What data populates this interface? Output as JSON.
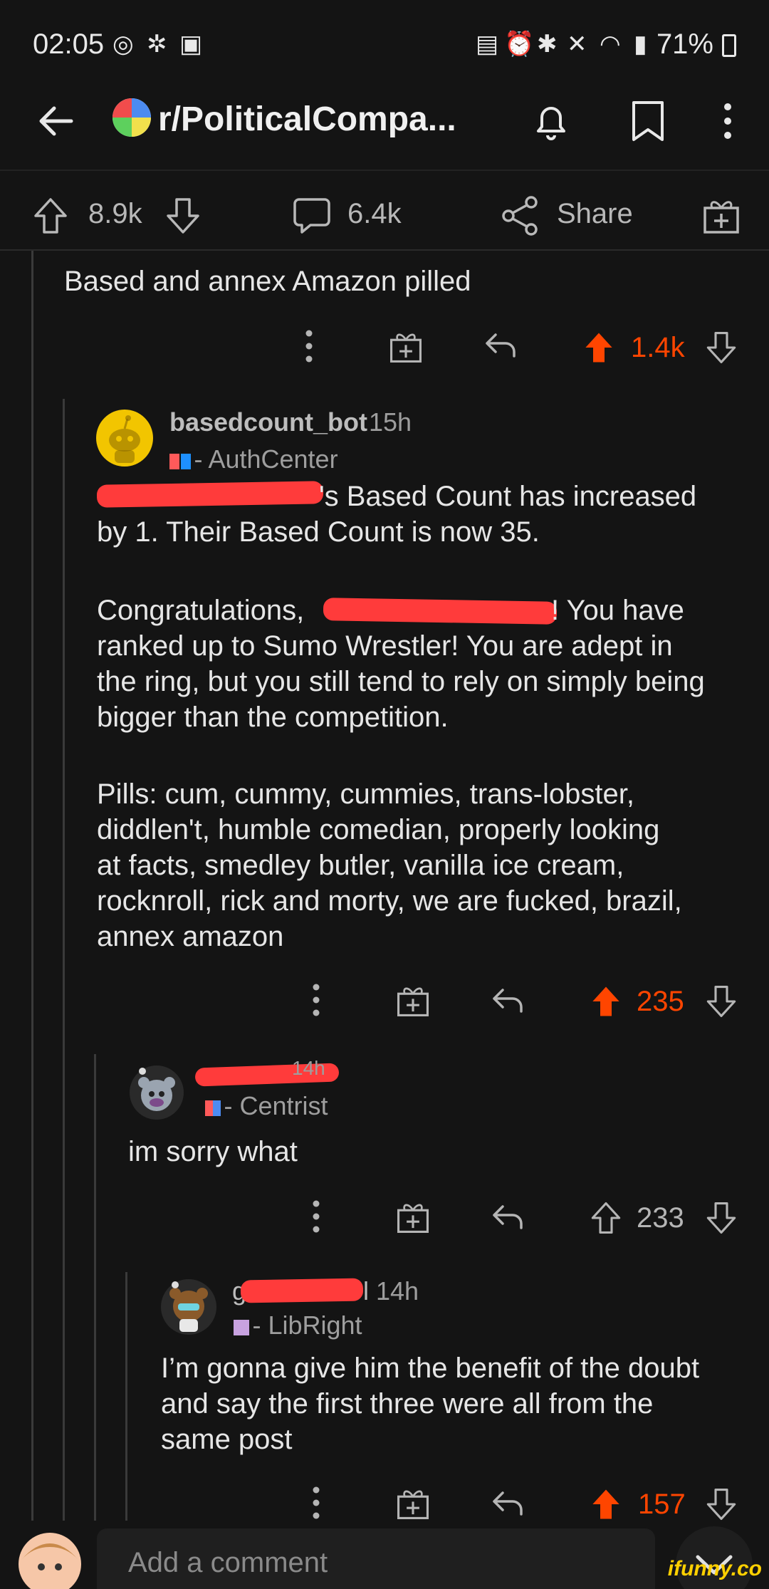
{
  "status_bar": {
    "time": "02:05",
    "battery_pct": "71%"
  },
  "header": {
    "subreddit": "r/PoliticalCompa..."
  },
  "post_actions": {
    "upvotes": "8.9k",
    "comments": "6.4k",
    "share_label": "Share"
  },
  "comments": [
    {
      "text": "Based and annex Amazon pilled",
      "score": "1.4k"
    },
    {
      "username": "basedcount_bot",
      "age": "15h",
      "flair": "- AuthCenter",
      "p1_tail": "'s Based Count has increased",
      "p1_line2": "by 1. Their Based Count is now 35.",
      "p2_head": "Congratulations,",
      "p2_tail": "! You have",
      "p2_rest": [
        "ranked up to Sumo Wrestler! You are adept in",
        "the ring, but you still tend to rely on simply being",
        "bigger than the competition."
      ],
      "p3": [
        "Pills: cum, cummy, cummies, trans-lobster,",
        "diddlen't, humble comedian, properly looking",
        "at facts, smedley butler, vanilla ice cream,",
        "rocknroll, rick and morty, we are fucked, brazil,",
        "annex amazon"
      ],
      "score": "235"
    },
    {
      "age": "14h",
      "flair": "- Centrist",
      "text": "im sorry what",
      "score": "233"
    },
    {
      "name_head": "g",
      "name_tail": "l",
      "age": "14h",
      "flair": "- LibRight",
      "lines": [
        "I’m gonna give him the benefit of the doubt",
        "and say the first three were all from the",
        "same post"
      ],
      "score": "157"
    }
  ],
  "composer": {
    "placeholder": "Add a comment"
  },
  "watermark": "ifunny.co",
  "colors": {
    "accent": "#ff4500",
    "background": "#141414",
    "authcenter_red": "#ff5a5a",
    "authcenter_blue": "#1e90ff",
    "libright_purple": "#c8a2e0"
  }
}
